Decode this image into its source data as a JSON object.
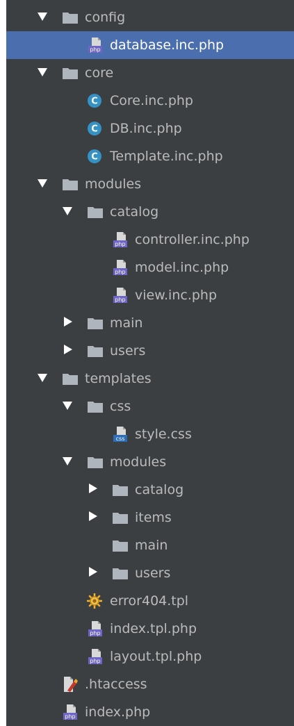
{
  "tree": [
    {
      "label": "config",
      "kind": "folder",
      "state": "expanded",
      "depth": 0
    },
    {
      "label": "database.inc.php",
      "kind": "php",
      "depth": 1,
      "selected": true
    },
    {
      "label": "core",
      "kind": "folder",
      "state": "expanded",
      "depth": 0
    },
    {
      "label": "Core.inc.php",
      "kind": "class",
      "depth": 1
    },
    {
      "label": "DB.inc.php",
      "kind": "class",
      "depth": 1
    },
    {
      "label": "Template.inc.php",
      "kind": "class",
      "depth": 1
    },
    {
      "label": "modules",
      "kind": "folder",
      "state": "expanded",
      "depth": 0
    },
    {
      "label": "catalog",
      "kind": "folder",
      "state": "expanded",
      "depth": 1
    },
    {
      "label": "controller.inc.php",
      "kind": "php",
      "depth": 2
    },
    {
      "label": "model.inc.php",
      "kind": "php",
      "depth": 2
    },
    {
      "label": "view.inc.php",
      "kind": "php",
      "depth": 2
    },
    {
      "label": "main",
      "kind": "folder",
      "state": "collapsed",
      "depth": 1
    },
    {
      "label": "users",
      "kind": "folder",
      "state": "collapsed",
      "depth": 1
    },
    {
      "label": "templates",
      "kind": "folder",
      "state": "expanded",
      "depth": 0
    },
    {
      "label": "css",
      "kind": "folder",
      "state": "expanded",
      "depth": 1
    },
    {
      "label": "style.css",
      "kind": "css",
      "depth": 2
    },
    {
      "label": "modules",
      "kind": "folder",
      "state": "expanded",
      "depth": 1
    },
    {
      "label": "catalog",
      "kind": "folder",
      "state": "collapsed",
      "depth": 2
    },
    {
      "label": "items",
      "kind": "folder",
      "state": "collapsed",
      "depth": 2
    },
    {
      "label": "main",
      "kind": "folder",
      "state": "leaf",
      "depth": 2
    },
    {
      "label": "users",
      "kind": "folder",
      "state": "collapsed",
      "depth": 2
    },
    {
      "label": "error404.tpl",
      "kind": "tpl",
      "depth": 1
    },
    {
      "label": "index.tpl.php",
      "kind": "php",
      "depth": 1
    },
    {
      "label": "layout.tpl.php",
      "kind": "php",
      "depth": 1
    },
    {
      "label": ".htaccess",
      "kind": "htaccess",
      "depth": 0
    },
    {
      "label": "index.php",
      "kind": "php",
      "depth": 0
    }
  ],
  "icons": {
    "folder": "folder-icon",
    "php": "php-file-icon",
    "class": "php-class-icon",
    "css": "css-file-icon",
    "tpl": "template-file-icon",
    "htaccess": "htaccess-file-icon"
  },
  "colors": {
    "panel_bg": "#3c3f41",
    "selected_bg": "#4b6eaf",
    "text": "#bbbbbb",
    "folder": "#aeb5bd",
    "php_badge": "#6e65c4",
    "class_badge": "#3592c4",
    "css_badge": "#2d6db5"
  },
  "glyphs": {
    "php_badge": "php",
    "class_badge": "C",
    "css_badge": "css"
  }
}
